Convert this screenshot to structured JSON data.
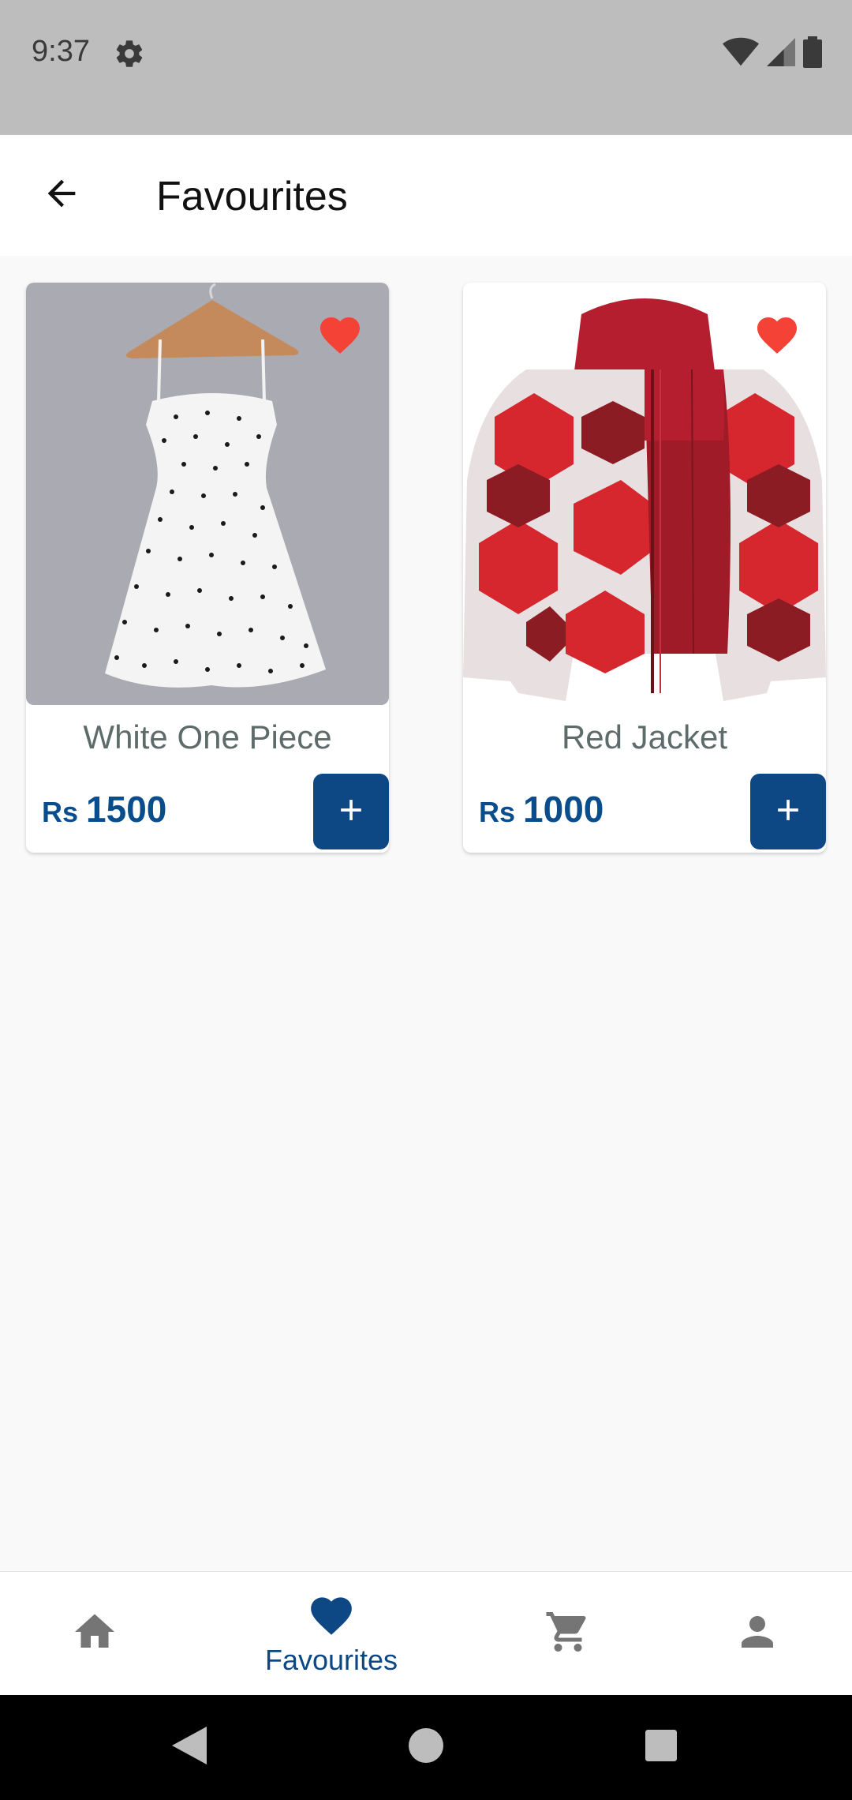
{
  "status_bar": {
    "time": "9:37",
    "icons": [
      "settings-icon",
      "wifi-icon",
      "signal-icon",
      "battery-icon"
    ]
  },
  "app_bar": {
    "title": "Favourites",
    "back_icon": "arrow-left-icon"
  },
  "products": [
    {
      "name": "White One Piece",
      "currency": "Rs",
      "price": "1500",
      "favourite": true,
      "image": "white polka dot dress on hanger"
    },
    {
      "name": "Red Jacket",
      "currency": "Rs",
      "price": "1000",
      "favourite": true,
      "image": "red patterned puffer jacket"
    }
  ],
  "bottom_nav": {
    "items": [
      {
        "icon": "home-icon",
        "label": ""
      },
      {
        "icon": "heart-icon",
        "label": "Favourites",
        "active": true
      },
      {
        "icon": "cart-icon",
        "label": ""
      },
      {
        "icon": "person-icon",
        "label": ""
      }
    ]
  },
  "colors": {
    "primary": "#0d4784",
    "price": "#0a4d8c",
    "favourite": "#f44336",
    "title_gray": "#5e6b6b",
    "background": "#f9f9f9",
    "status_bar": "#bdbdbd"
  }
}
